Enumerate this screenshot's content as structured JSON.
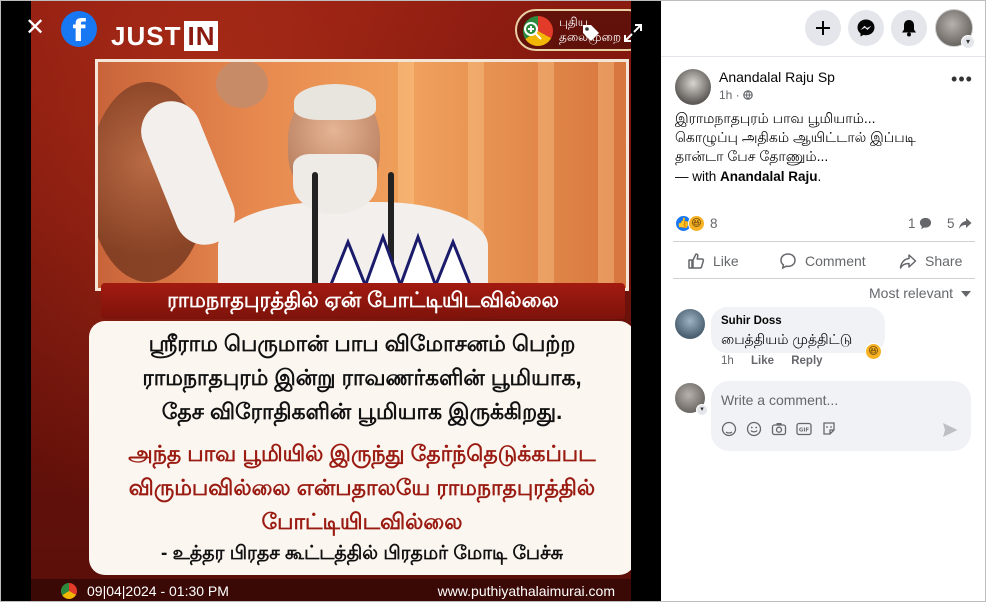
{
  "viewer": {
    "close_label": "✕",
    "fb_logo": "f",
    "image": {
      "just_in": "JUST",
      "just_in_suffix": "IN",
      "channel_logo_line1": "புதிய",
      "channel_logo_line2": "தலைமுறை",
      "headline": "ராமநாதபுரத்தில் ஏன் போட்டியிடவில்லை",
      "quote_black": [
        "ஸ்ரீராம பெருமான் பாப விமோசனம் பெற்ற",
        "ராமநாதபுரம் இன்று ராவணர்களின் பூமியாக,",
        "தேச விரோதிகளின் பூமியாக இருக்கிறது."
      ],
      "quote_red": [
        "அந்த பாவ பூமியில் இருந்து தேர்ந்தெடுக்கப்பட",
        "விரும்பவில்லை என்பதாலயே ராமநாதபுரத்தில்",
        "போட்டியிடவில்லை"
      ],
      "attribution": "- உத்தர பிரதச கூட்டத்தில் பிரதமர் மோடி பேச்சு",
      "date": "09|04|2024 - 01:30 PM",
      "url": "www.puthiyathalaimurai.com"
    },
    "icons": [
      "close-icon",
      "facebook-logo-icon",
      "zoom-in-icon",
      "tag-icon",
      "fullscreen-icon"
    ]
  },
  "topbar": {
    "icons": [
      "plus-icon",
      "messenger-icon",
      "bell-icon",
      "profile-avatar"
    ]
  },
  "post": {
    "author": "Anandalal Raju Sp",
    "time": "1h · ",
    "more_label": "•••",
    "text_lines": [
      "இராமநாதபுரம் பாவ பூமியாம்...",
      "கொழுப்பு அதிகம் ஆயிட்டால் இப்படி",
      "தான்டா பேச தோணும்..."
    ],
    "with_prefix": "— with ",
    "with_name": "Anandalal Raju",
    "with_suffix": ".",
    "reaction_count": "8",
    "comment_count": "1",
    "share_count": "5"
  },
  "actions": {
    "like": "Like",
    "comment": "Comment",
    "share": "Share"
  },
  "sort": {
    "label": "Most relevant"
  },
  "comments": [
    {
      "author": "Suhir Doss",
      "text": "பைத்தியம் முத்திட்டு",
      "time": "1h",
      "like": "Like",
      "reply": "Reply"
    }
  ],
  "composer": {
    "placeholder": "Write a comment..."
  },
  "colors": {
    "facebook_blue": "#1877f2",
    "headline_red": "#a31a10",
    "quote_red": "#9a1b12"
  }
}
